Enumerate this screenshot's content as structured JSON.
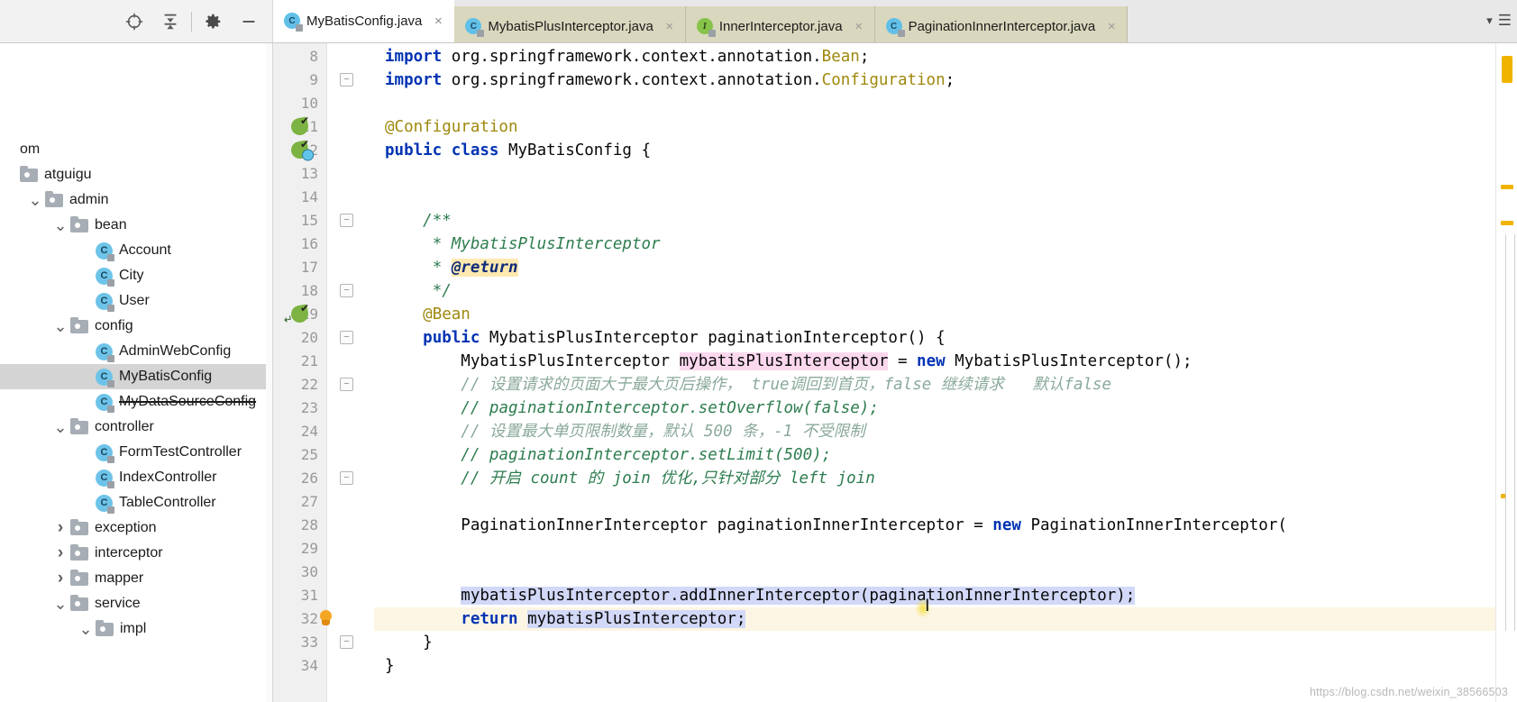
{
  "toolbar": {
    "icons": [
      {
        "name": "locate-target-icon",
        "glyph": "locate"
      },
      {
        "name": "collapse-all-icon",
        "glyph": "collapse"
      },
      {
        "name": "settings-gear-icon",
        "glyph": "gear"
      },
      {
        "name": "hide-panel-icon",
        "glyph": "minus"
      }
    ]
  },
  "tabs": {
    "items": [
      {
        "label": "MyBatisConfig.java",
        "icon": "java-class-icon",
        "kind": "c",
        "active": true
      },
      {
        "label": "MybatisPlusInterceptor.java",
        "icon": "java-class-icon",
        "kind": "c",
        "active": false
      },
      {
        "label": "InnerInterceptor.java",
        "icon": "java-interface-icon",
        "kind": "i",
        "active": false
      },
      {
        "label": "PaginationInnerInterceptor.java",
        "icon": "java-class-icon",
        "kind": "c",
        "active": false
      }
    ],
    "close_glyph": "×",
    "overflow_glyph": "▾",
    "list_glyph": "☰"
  },
  "sidebar": {
    "tree": [
      {
        "label": "om",
        "indent": 0,
        "type": "text",
        "arrow": "",
        "cut": true
      },
      {
        "label": "atguigu",
        "indent": 0,
        "type": "folder",
        "arrow": ""
      },
      {
        "label": "admin",
        "indent": 1,
        "type": "folder",
        "arrow": "⌄"
      },
      {
        "label": "bean",
        "indent": 2,
        "type": "folder",
        "arrow": "⌄"
      },
      {
        "label": "Account",
        "indent": 3,
        "type": "class",
        "arrow": ""
      },
      {
        "label": "City",
        "indent": 3,
        "type": "class",
        "arrow": ""
      },
      {
        "label": "User",
        "indent": 3,
        "type": "class",
        "arrow": ""
      },
      {
        "label": "config",
        "indent": 2,
        "type": "folder",
        "arrow": "⌄"
      },
      {
        "label": "AdminWebConfig",
        "indent": 3,
        "type": "class",
        "arrow": ""
      },
      {
        "label": "MyBatisConfig",
        "indent": 3,
        "type": "class",
        "arrow": "",
        "selected": true
      },
      {
        "label": "MyDataSourceConfig",
        "indent": 3,
        "type": "class",
        "arrow": "",
        "strike": true
      },
      {
        "label": "controller",
        "indent": 2,
        "type": "folder",
        "arrow": "⌄"
      },
      {
        "label": "FormTestController",
        "indent": 3,
        "type": "class",
        "arrow": ""
      },
      {
        "label": "IndexController",
        "indent": 3,
        "type": "class",
        "arrow": ""
      },
      {
        "label": "TableController",
        "indent": 3,
        "type": "class",
        "arrow": ""
      },
      {
        "label": "exception",
        "indent": 2,
        "type": "folder",
        "arrow": "›"
      },
      {
        "label": "interceptor",
        "indent": 2,
        "type": "folder",
        "arrow": "›"
      },
      {
        "label": "mapper",
        "indent": 2,
        "type": "folder",
        "arrow": "›"
      },
      {
        "label": "service",
        "indent": 2,
        "type": "folder",
        "arrow": "⌄"
      },
      {
        "label": "impl",
        "indent": 3,
        "type": "folder",
        "arrow": "⌄"
      }
    ]
  },
  "editor": {
    "file": "MyBatisConfig.java",
    "first_line": 8,
    "lines": [
      {
        "n": 8,
        "html": "<span class=\"kw\">import</span> org.springframework.context.annotation.<span class=\"ann\">Bean</span>;"
      },
      {
        "n": 9,
        "html": "<span class=\"kw\">import</span> org.springframework.context.annotation.<span class=\"ann\">Configuration</span>;"
      },
      {
        "n": 10,
        "html": ""
      },
      {
        "n": 11,
        "html": "<span class=\"ann\">@Configuration</span>"
      },
      {
        "n": 12,
        "html": "<span class=\"kw\">public</span> <span class=\"kw\">class</span> MyBatisConfig {"
      },
      {
        "n": 13,
        "html": ""
      },
      {
        "n": 14,
        "html": ""
      },
      {
        "n": 15,
        "html": "    <span class=\"jdoc\">/**</span>"
      },
      {
        "n": 16,
        "html": "     <span class=\"jdoc\">* MybatisPlusInterceptor</span>"
      },
      {
        "n": 17,
        "html": "     <span class=\"jdoc\">* </span><span class=\"jtag\">@return</span>"
      },
      {
        "n": 18,
        "html": "     <span class=\"jdoc\">*/</span>"
      },
      {
        "n": 19,
        "html": "    <span class=\"ann\">@Bean</span>"
      },
      {
        "n": 20,
        "html": "    <span class=\"kw\">public</span> MybatisPlusInterceptor paginationInterceptor() {"
      },
      {
        "n": 21,
        "html": "        MybatisPlusInterceptor <span class=\"hl-pink\">mybatisPlusInterceptor</span> = <span class=\"kw\">new</span> MybatisPlusInterceptor();"
      },
      {
        "n": 22,
        "html": "        <span class=\"cmt-dim\">// 设置请求的页面大于最大页后操作， true调回到首页，false 继续请求   默认false</span>"
      },
      {
        "n": 23,
        "html": "        <span class=\"cmt\">// paginationInterceptor.setOverflow(false);</span>"
      },
      {
        "n": 24,
        "html": "        <span class=\"cmt-dim\">// 设置最大单页限制数量，默认 500 条，-1 不受限制</span>"
      },
      {
        "n": 25,
        "html": "        <span class=\"cmt\">// paginationInterceptor.setLimit(500);</span>"
      },
      {
        "n": 26,
        "html": "        <span class=\"cmt\">// 开启 count 的 join 优化,只针对部分 left join</span>"
      },
      {
        "n": 27,
        "html": ""
      },
      {
        "n": 28,
        "html": "        PaginationInnerInterceptor paginationInnerInterceptor = <span class=\"kw\">new</span> PaginationInnerInterceptor("
      },
      {
        "n": 29,
        "html": ""
      },
      {
        "n": 30,
        "html": ""
      },
      {
        "n": 31,
        "html": "        <span class=\"hl-sel\">mybatisPlusInterceptor.addInnerInterceptor(paginationInnerInterceptor);</span>"
      },
      {
        "n": 32,
        "html": "        <span class=\"kw\">return</span> <span class=\"hl-sel\">mybatisPlusInterceptor;</span>"
      },
      {
        "n": 33,
        "html": "    }"
      },
      {
        "n": 34,
        "html": "}"
      }
    ],
    "caret_line": 32,
    "bulb_line": 32,
    "bean_gutter_lines": [
      11,
      12,
      19
    ],
    "fold_lines": [
      9,
      15,
      18,
      20,
      22,
      26,
      33
    ]
  },
  "watermark": {
    "text": "https://blog.csdn.net/weixin_38566503"
  },
  "colors": {
    "accent_tab_active": "#ffffff",
    "tab_inactive": "#d9d7bd",
    "keyword": "#0033b3",
    "annotation": "#9e880d",
    "comment": "#2e7d4f",
    "selection": "#d2d8f7",
    "caret_row": "#fcf5e3",
    "marker_warning": "#f0b400",
    "class_icon": "#6ec3e8",
    "interface_icon": "#86c34a",
    "folder_icon": "#a6adb4"
  }
}
